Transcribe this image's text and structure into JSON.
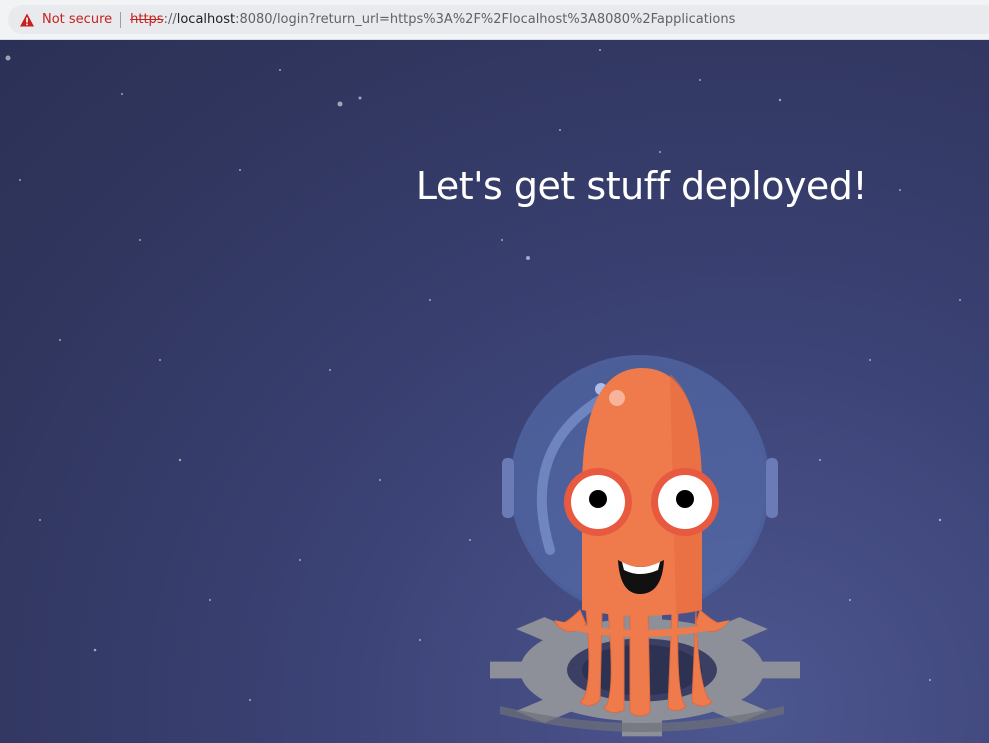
{
  "browser": {
    "security_label": "Not secure",
    "url_scheme": "https",
    "url_sep": "://",
    "url_host": "localhost",
    "url_rest": ":8080/login?return_url=https%3A%2F%2Flocalhost%3A8080%2Fapplications",
    "icons": {
      "security": "warning-triangle-icon"
    },
    "colors": {
      "warning": "#c5221f"
    }
  },
  "page": {
    "headline": "Let's get stuff deployed!",
    "mascot": "argo-octopus-astronaut",
    "colors": {
      "background": "#343a66",
      "octopus": "#ef7b4d",
      "gear": "#8a8c95"
    }
  }
}
